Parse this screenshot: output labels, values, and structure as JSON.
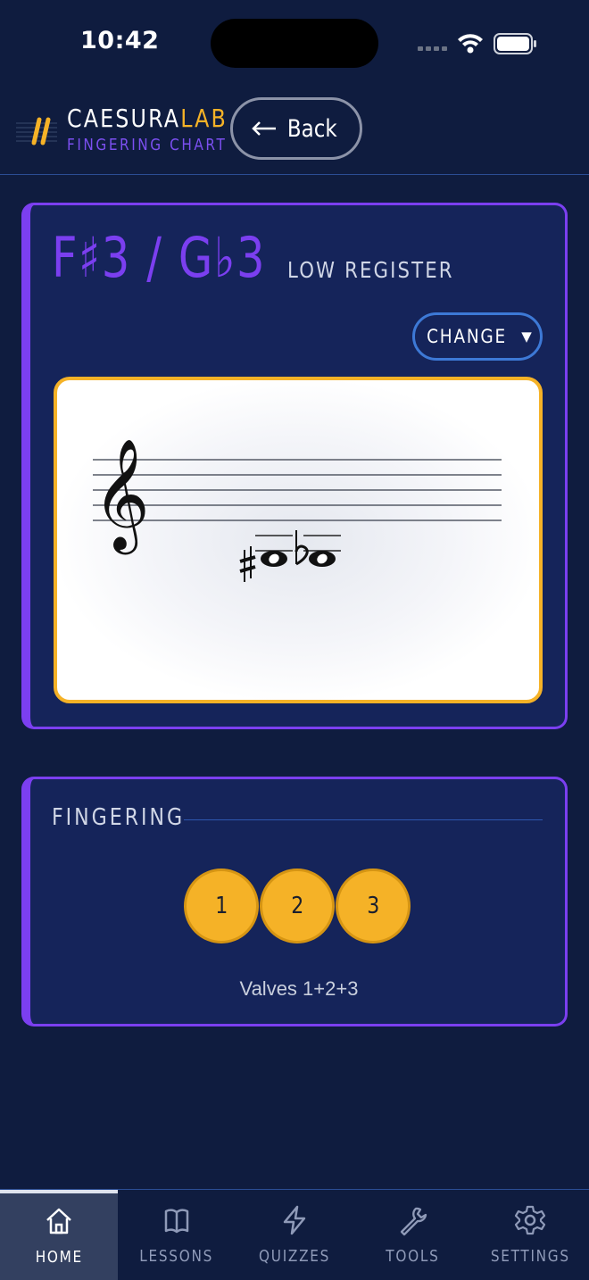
{
  "status": {
    "time": "10:42"
  },
  "header": {
    "brand_part1": "CAESURA",
    "brand_part2": "LAB",
    "subtitle": "FINGERING CHART",
    "back_label": "Back"
  },
  "note": {
    "name": "F♯3 / G♭3",
    "register": "LOW REGISTER",
    "change_label": "CHANGE"
  },
  "fingering": {
    "title": "FINGERING",
    "valves": [
      "1",
      "2",
      "3"
    ],
    "caption": "Valves 1+2+3"
  },
  "tabs": [
    {
      "label": "HOME",
      "icon": "home-icon",
      "active": true
    },
    {
      "label": "LESSONS",
      "icon": "book-icon",
      "active": false
    },
    {
      "label": "QUIZZES",
      "icon": "lightning-icon",
      "active": false
    },
    {
      "label": "TOOLS",
      "icon": "wrench-icon",
      "active": false
    },
    {
      "label": "SETTINGS",
      "icon": "gear-icon",
      "active": false
    }
  ],
  "colors": {
    "background": "#0f1c3f",
    "card": "#15245a",
    "accent_purple": "#7b3ff0",
    "accent_gold": "#f5b227",
    "accent_blue": "#3d79d6"
  }
}
